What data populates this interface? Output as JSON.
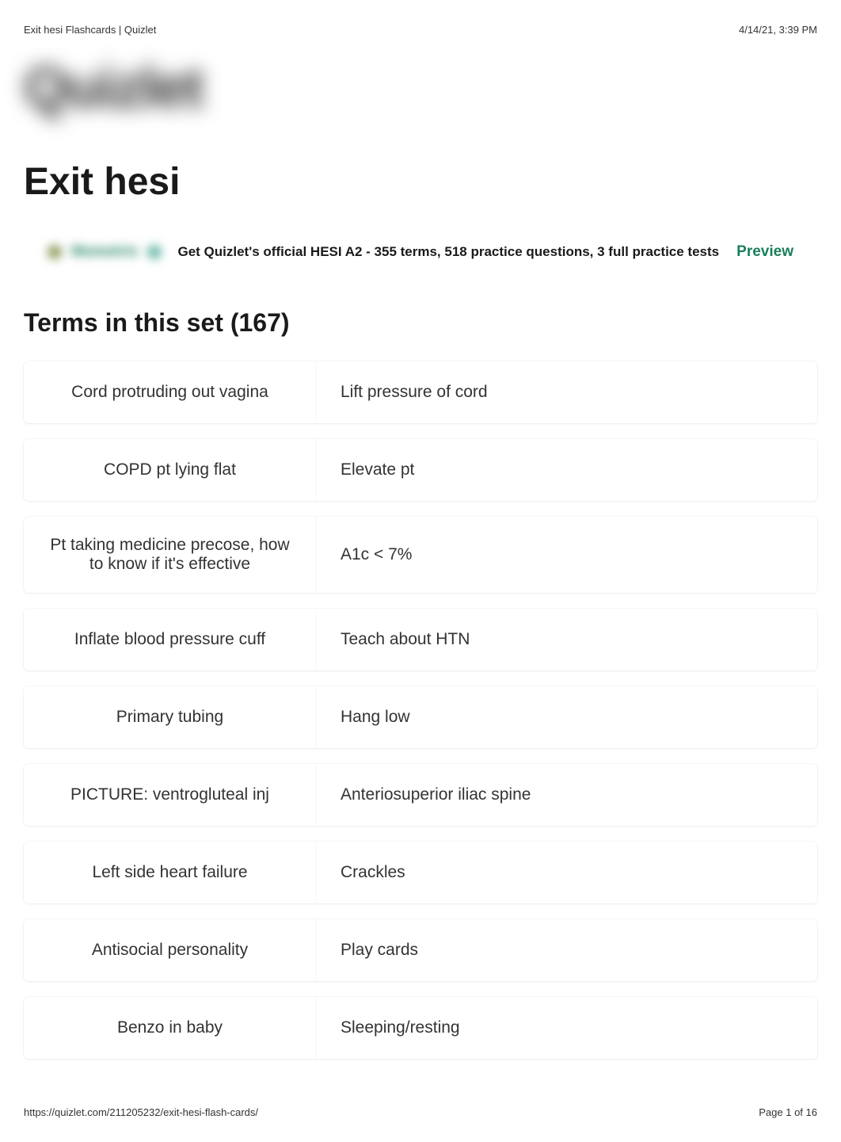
{
  "header": {
    "title": "Exit hesi Flashcards | Quizlet",
    "timestamp": "4/14/21, 3:39 PM"
  },
  "logo": "Quizlet",
  "pageTitle": "Exit hesi",
  "promo": {
    "brand": "Mometrix",
    "text": "Get Quizlet's official HESI A2 - 355 terms, 518 practice questions, 3 full practice tests",
    "previewLabel": "Preview"
  },
  "termsHeading": "Terms in this set (167)",
  "terms": [
    {
      "term": "Cord protruding out vagina",
      "definition": "Lift pressure of cord"
    },
    {
      "term": "COPD pt lying flat",
      "definition": "Elevate pt"
    },
    {
      "term": "Pt taking medicine precose, how to know if it's effective",
      "definition": "A1c < 7%"
    },
    {
      "term": "Inflate blood pressure cuff",
      "definition": "Teach about HTN"
    },
    {
      "term": "Primary tubing",
      "definition": "Hang low"
    },
    {
      "term": "PICTURE: ventrogluteal inj",
      "definition": "Anteriosuperior iliac spine"
    },
    {
      "term": "Left side heart failure",
      "definition": "Crackles"
    },
    {
      "term": "Antisocial personality",
      "definition": "Play cards"
    },
    {
      "term": "Benzo in baby",
      "definition": "Sleeping/resting"
    }
  ],
  "footer": {
    "url": "https://quizlet.com/211205232/exit-hesi-flash-cards/",
    "pageInfo": "Page 1 of 16"
  }
}
